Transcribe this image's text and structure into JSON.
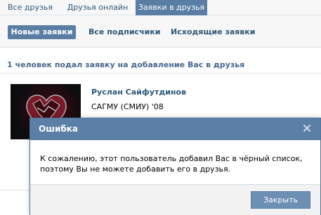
{
  "tabs": {
    "all_friends": "Все друзья",
    "friends_online": "Друзья онлайн",
    "friend_requests": "Заявки в друзья"
  },
  "subnav": {
    "new_requests": "Новые заявки",
    "all_subscribers": "Все подписчики",
    "outgoing_requests": "Исходящие заявки"
  },
  "requests": {
    "header": "1 человек подал заявку на добавление Вас в друзья",
    "items": [
      {
        "name": "Руслан Сайфутдинов",
        "education": "САГМУ (СМИУ) '08"
      }
    ]
  },
  "dialog": {
    "title": "Ошибка",
    "message": "К сожалению, этот пользователь добавил Вас в чёрный список, поэтому Вы не можете добавить его в друзья.",
    "close_button": "Закрыть",
    "close_icon": "close-x-icon"
  },
  "colors": {
    "accent": "#597da3",
    "link": "#2b587a",
    "header_text": "#45688e"
  }
}
